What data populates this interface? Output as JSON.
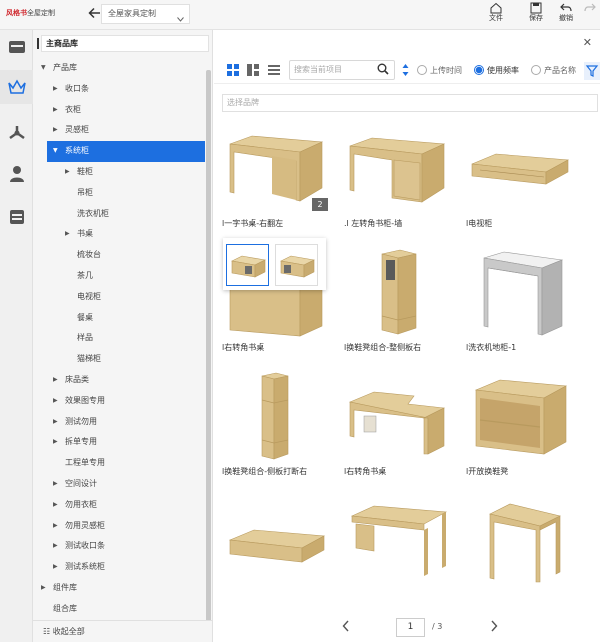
{
  "app": {
    "brand": "风格书",
    "brand_sub": "全屋定制",
    "doc_title": "全屋家具定制"
  },
  "toolbar_actions": [
    {
      "label": "文件",
      "icon": "home-icon"
    },
    {
      "label": "保存",
      "icon": "save-icon"
    },
    {
      "label": "撤销",
      "icon": "undo-icon"
    },
    {
      "label": "",
      "icon": "redo-icon"
    }
  ],
  "rail": [
    "cabinet-icon",
    "crown-icon",
    "model-icon",
    "user-icon",
    "store-icon"
  ],
  "library": {
    "title": "主商品库",
    "collapse_all": "收起全部",
    "tree": [
      {
        "label": "产品库",
        "level": 0,
        "arrow": "down"
      },
      {
        "label": "收口条",
        "level": 1,
        "arrow": "right"
      },
      {
        "label": "衣柜",
        "level": 1,
        "arrow": "right"
      },
      {
        "label": "灵感柜",
        "level": 1,
        "arrow": "right"
      },
      {
        "label": "系统柜",
        "level": 1,
        "arrow": "down",
        "selected": true
      },
      {
        "label": "鞋柜",
        "level": 2,
        "arrow": "right"
      },
      {
        "label": "吊柜",
        "level": 2,
        "arrow": ""
      },
      {
        "label": "洗衣机柜",
        "level": 2,
        "arrow": ""
      },
      {
        "label": "书桌",
        "level": 2,
        "arrow": "right"
      },
      {
        "label": "梳妆台",
        "level": 2,
        "arrow": ""
      },
      {
        "label": "茶几",
        "level": 2,
        "arrow": ""
      },
      {
        "label": "电视柜",
        "level": 2,
        "arrow": ""
      },
      {
        "label": "餐桌",
        "level": 2,
        "arrow": ""
      },
      {
        "label": "样品",
        "level": 2,
        "arrow": ""
      },
      {
        "label": "猫梯柜",
        "level": 2,
        "arrow": ""
      },
      {
        "label": "床品类",
        "level": 1,
        "arrow": "right"
      },
      {
        "label": "效果图专用",
        "level": 1,
        "arrow": "right"
      },
      {
        "label": "测试勿用",
        "level": 1,
        "arrow": "right"
      },
      {
        "label": "拆单专用",
        "level": 1,
        "arrow": "right"
      },
      {
        "label": "工程单专用",
        "level": 1,
        "arrow": ""
      },
      {
        "label": "空间设计",
        "level": 1,
        "arrow": "right"
      },
      {
        "label": "勿用衣柜",
        "level": 1,
        "arrow": "right"
      },
      {
        "label": "勿用灵感柜",
        "level": 1,
        "arrow": "right"
      },
      {
        "label": "测试收口条",
        "level": 1,
        "arrow": "right"
      },
      {
        "label": "测试系统柜",
        "level": 1,
        "arrow": "right"
      },
      {
        "label": "组件库",
        "level": 0,
        "arrow": "right"
      },
      {
        "label": "组合库",
        "level": 0,
        "arrow": ""
      }
    ]
  },
  "filters": {
    "search_placeholder": "搜索当前项目",
    "brand_placeholder": "选择品牌",
    "options": [
      {
        "label": "上传时间",
        "checked": false
      },
      {
        "label": "使用频率",
        "checked": true
      },
      {
        "label": "产品名称",
        "checked": false
      }
    ]
  },
  "products": [
    {
      "name": "l一字书桌-右翻左",
      "shape": "desk-simple",
      "badge": "2"
    },
    {
      "name": ".l 左转角书柜-墙",
      "shape": "desk-drawer",
      "badge": ""
    },
    {
      "name": "l电视柜",
      "shape": "tv",
      "badge": ""
    },
    {
      "name": "l右转角书桌",
      "shape": "desk-under",
      "badge": ""
    },
    {
      "name": "l换鞋凳组合-整侧板右",
      "shape": "tall",
      "badge": ""
    },
    {
      "name": "l洗衣机地柜-1",
      "shape": "washer",
      "badge": ""
    },
    {
      "name": "l换鞋凳组合-侧板打断右",
      "shape": "tall2",
      "badge": ""
    },
    {
      "name": "l右转角书桌",
      "shape": "corner",
      "badge": ""
    },
    {
      "name": "l开放换鞋凳",
      "shape": "bench",
      "badge": ""
    },
    {
      "name": "",
      "shape": "low",
      "badge": ""
    },
    {
      "name": "",
      "shape": "desk-drawer2",
      "badge": ""
    },
    {
      "name": "",
      "shape": "frame",
      "badge": ""
    }
  ],
  "pagination": {
    "current": "1",
    "total": "/ 3"
  },
  "colors": {
    "accent": "#1d6fe0",
    "wood": "#e3cd9a",
    "wood_dark": "#c5a86c",
    "brand_red": "#d0282e"
  }
}
